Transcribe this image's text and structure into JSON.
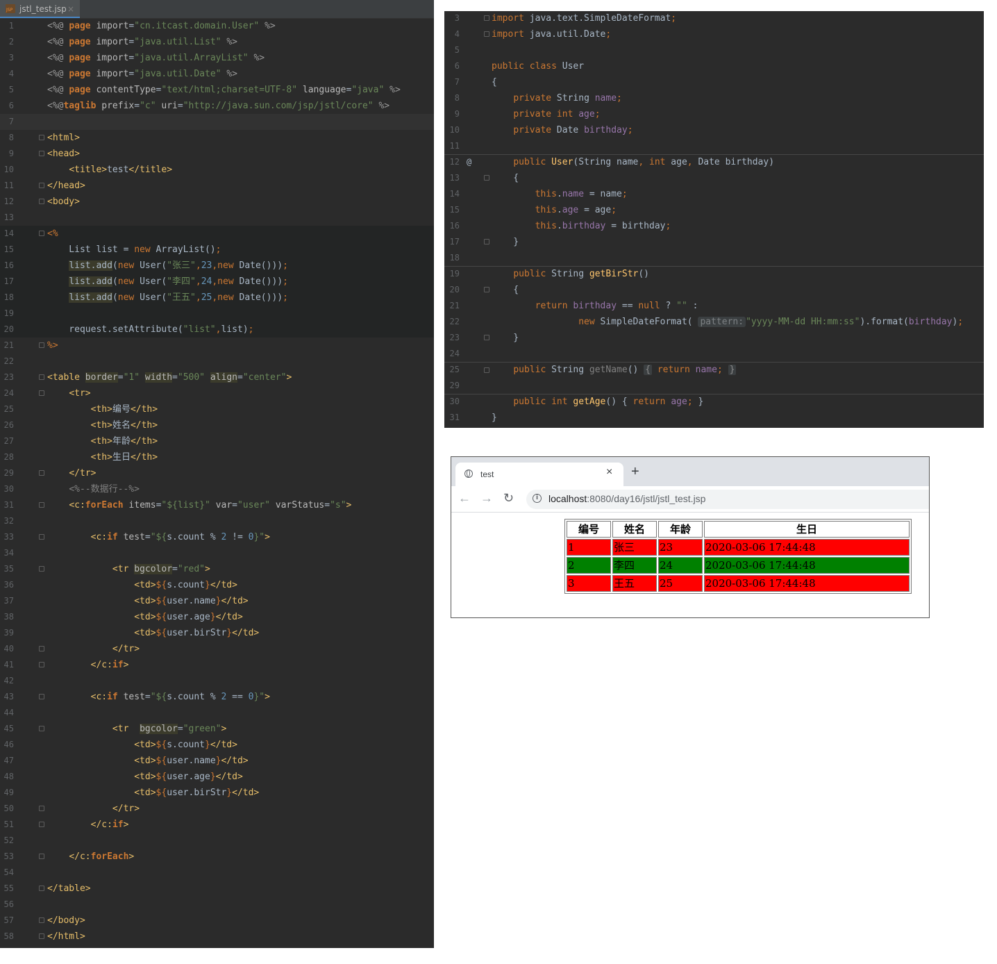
{
  "left_editor": {
    "tab": {
      "icon": "jsp-file-icon",
      "label": "jstl_test.jsp",
      "close": "×"
    },
    "line_numbers": [
      "1",
      "2",
      "3",
      "4",
      "5",
      "6",
      "7",
      "8",
      "9",
      "10",
      "11",
      "12",
      "13",
      "14",
      "15",
      "16",
      "17",
      "18",
      "19",
      "20",
      "21",
      "22",
      "23",
      "24",
      "25",
      "26",
      "27",
      "28",
      "29",
      "30",
      "31",
      "32",
      "33",
      "34",
      "35",
      "36",
      "37",
      "38",
      "39",
      "40",
      "41",
      "42",
      "43",
      "44",
      "45",
      "46",
      "47",
      "48",
      "49",
      "50",
      "51",
      "52",
      "53",
      "54",
      "55",
      "56",
      "57",
      "58"
    ],
    "lines": [
      "<%@ page import=\"cn.itcast.domain.User\" %>",
      "<%@ page import=\"java.util.List\" %>",
      "<%@ page import=\"java.util.ArrayList\" %>",
      "<%@ page import=\"java.util.Date\" %>",
      "<%@ page contentType=\"text/html;charset=UTF-8\" language=\"java\" %>",
      "<%@taglib prefix=\"c\" uri=\"http://java.sun.com/jsp/jstl/core\" %>",
      "",
      "<html>",
      "<head>",
      "    <title>test</title>",
      "</head>",
      "<body>",
      "",
      "<%",
      "    List list = new ArrayList();",
      "    list.add(new User(\"张三\",23,new Date()));",
      "    list.add(new User(\"李四\",24,new Date()));",
      "    list.add(new User(\"王五\",25,new Date()));",
      "",
      "    request.setAttribute(\"list\",list);",
      "%>",
      "",
      "<table border=\"1\" width=\"500\" align=\"center\">",
      "    <tr>",
      "        <th>编号</th>",
      "        <th>姓名</th>",
      "        <th>年龄</th>",
      "        <th>生日</th>",
      "    </tr>",
      "    <%--数据行--%>",
      "    <c:forEach items=\"${list}\" var=\"user\" varStatus=\"s\">",
      "",
      "        <c:if test=\"${s.count % 2 != 0}\">",
      "",
      "            <tr bgcolor=\"red\">",
      "                <td>${s.count}</td>",
      "                <td>${user.name}</td>",
      "                <td>${user.age}</td>",
      "                <td>${user.birStr}</td>",
      "            </tr>",
      "        </c:if>",
      "",
      "        <c:if test=\"${s.count % 2 == 0}\">",
      "",
      "            <tr  bgcolor=\"green\">",
      "                <td>${s.count}</td>",
      "                <td>${user.name}</td>",
      "                <td>${user.age}</td>",
      "                <td>${user.birStr}</td>",
      "            </tr>",
      "        </c:if>",
      "",
      "    </c:forEach>",
      "",
      "</table>",
      "",
      "</body>",
      "</html>"
    ]
  },
  "right_editor": {
    "line_numbers": [
      "3",
      "4",
      "5",
      "6",
      "7",
      "8",
      "9",
      "10",
      "11",
      "12",
      "13",
      "14",
      "15",
      "16",
      "17",
      "18",
      "19",
      "20",
      "21",
      "22",
      "23",
      "24",
      "25",
      "29",
      "30",
      "31"
    ],
    "override_marker": "@",
    "param_hint": "pattern:",
    "lines": [
      "import java.text.SimpleDateFormat;",
      "import java.util.Date;",
      "",
      "public class User",
      "{",
      "    private String name;",
      "    private int age;",
      "    private Date birthday;",
      "",
      "    public User(String name, int age, Date birthday)",
      "    {",
      "        this.name = name;",
      "        this.age = age;",
      "        this.birthday = birthday;",
      "    }",
      "",
      "    public String getBirStr()",
      "    {",
      "        return birthday == null ? \"\" :",
      "                new SimpleDateFormat( pattern: \"yyyy-MM-dd HH:mm:ss\").format(birthday);",
      "    }",
      "",
      "    public String getName() { return name; }",
      "",
      "    public int getAge() { return age; }",
      "}"
    ]
  },
  "browser": {
    "tab_title": "test",
    "tab_close": "×",
    "new_tab": "+",
    "back_icon": "←",
    "forward_icon": "→",
    "reload_icon": "↻",
    "info_icon": "i",
    "url_host": "localhost",
    "url_rest": ":8080/day16/jstl/jstl_test.jsp",
    "table": {
      "headers": [
        "编号",
        "姓名",
        "年龄",
        "生日"
      ],
      "rows": [
        {
          "bgcolor": "#ff0000",
          "cells": [
            "1",
            "张三",
            "23",
            "2020-03-06 17:44:48"
          ]
        },
        {
          "bgcolor": "#008000",
          "cells": [
            "2",
            "李四",
            "24",
            "2020-03-06 17:44:48"
          ]
        },
        {
          "bgcolor": "#ff0000",
          "cells": [
            "3",
            "王五",
            "25",
            "2020-03-06 17:44:48"
          ]
        }
      ]
    }
  },
  "colors": {
    "editor_bg": "#2b2b2b",
    "keyword": "#cc7832",
    "string": "#6a8759",
    "number": "#6897bb",
    "tag": "#e8bf6a",
    "field": "#9876aa",
    "method": "#ffc66d",
    "comment": "#808080",
    "row_red": "#ff0000",
    "row_green": "#008000"
  }
}
